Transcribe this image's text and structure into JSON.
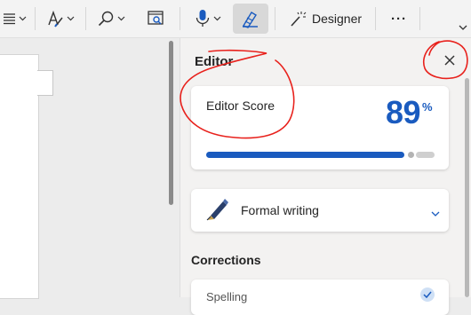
{
  "toolbar": {
    "designer_label": "Designer",
    "more_label": "···"
  },
  "editor": {
    "title": "Editor",
    "score_label": "Editor Score",
    "score_value": "89",
    "score_unit": "%",
    "score_progress": 0.89,
    "formal_label": "Formal writing",
    "corrections_label": "Corrections",
    "spelling_label": "Spelling"
  },
  "colors": {
    "accent": "#1a5bbf",
    "annotation": "#e8211c"
  }
}
